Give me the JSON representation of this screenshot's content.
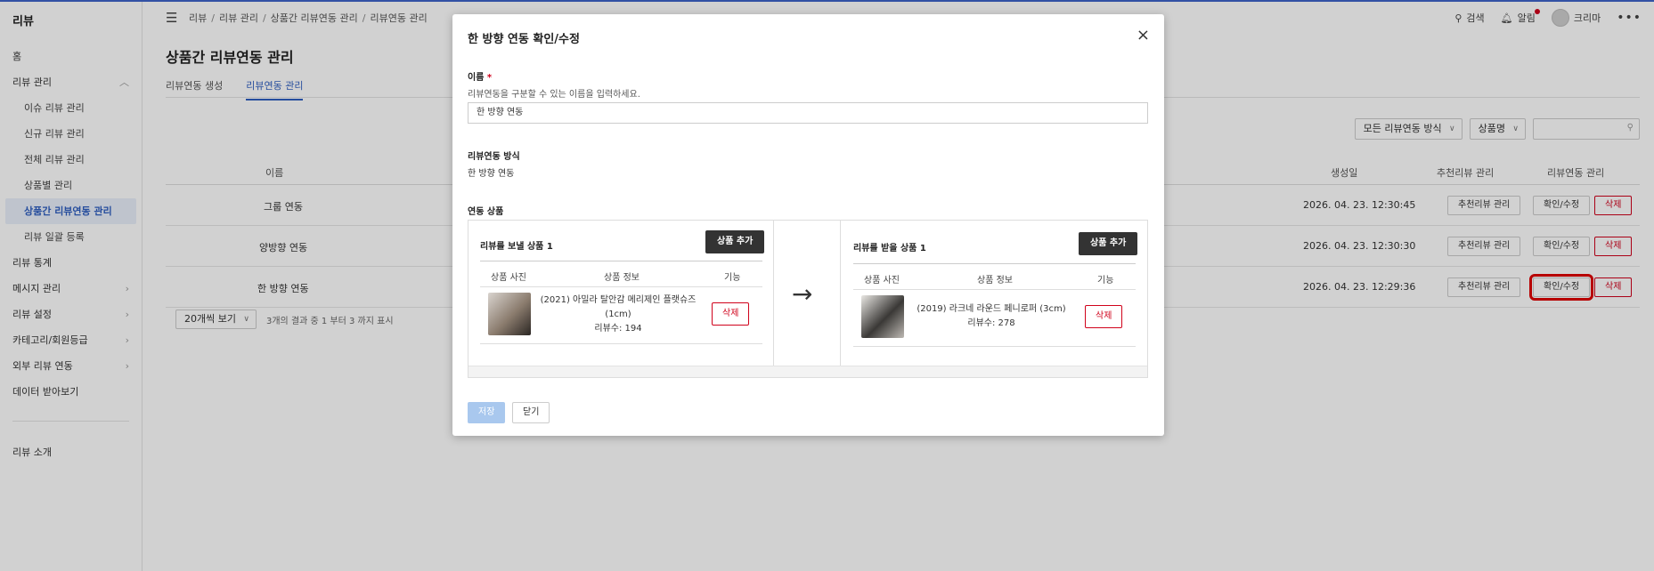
{
  "sidebar": {
    "brand": "리뷰",
    "items": [
      {
        "label": "홈"
      },
      {
        "label": "리뷰 관리"
      },
      {
        "label": "이슈 리뷰 관리"
      },
      {
        "label": "신규 리뷰 관리"
      },
      {
        "label": "전체 리뷰 관리"
      },
      {
        "label": "상품별 관리"
      },
      {
        "label": "상품간 리뷰연동 관리"
      },
      {
        "label": "리뷰 일괄 등록"
      },
      {
        "label": "리뷰 통계"
      },
      {
        "label": "메시지 관리"
      },
      {
        "label": "리뷰 설정"
      },
      {
        "label": "카테고리/회원등급"
      },
      {
        "label": "외부 리뷰 연동"
      },
      {
        "label": "데이터 받아보기"
      },
      {
        "label": "리뷰 소개"
      }
    ]
  },
  "header": {
    "breadcrumb": [
      "리뷰",
      "리뷰 관리",
      "상품간 리뷰연동 관리",
      "리뷰연동 관리"
    ],
    "search_label": "검색",
    "alarm_label": "알림",
    "user_name": "크리마",
    "more": "•••"
  },
  "page": {
    "title": "상품간 리뷰연동 관리",
    "tabs": [
      {
        "label": "리뷰연동 생성"
      },
      {
        "label": "리뷰연동 관리"
      }
    ]
  },
  "filters": {
    "mode_select": "모든 리뷰연동 방식",
    "field_select": "상품명"
  },
  "table": {
    "columns": [
      "이름",
      "생성일",
      "추천리뷰 관리",
      "리뷰연동 관리"
    ],
    "rows": [
      {
        "name": "그룹 연동",
        "created": "2026. 04. 23. 12:30:45"
      },
      {
        "name": "양방향 연동",
        "created": "2026. 04. 23. 12:30:30"
      },
      {
        "name": "한 방향 연동",
        "created": "2026. 04. 23. 12:29:36"
      }
    ],
    "recommend_btn": "추천리뷰 관리",
    "edit_btn": "확인/수정",
    "delete_btn": "삭제"
  },
  "pager": {
    "per_page": "20개씩 보기",
    "summary": "3개의 결과 중 1 부터 3 까지 표시"
  },
  "modal": {
    "title": "한 방향 연동 확인/수정",
    "close_icon": "×",
    "name_label": "이름",
    "required_mark": "*",
    "name_help": "리뷰연동을 구분할 수 있는 이름을 입력하세요.",
    "name_value": "한 방향 연동",
    "mode_label": "리뷰연동 방식",
    "mode_value": "한 방향 연동",
    "products_label": "연동 상품",
    "arrow": "→",
    "left": {
      "title": "리뷰를 보낼 상품 1",
      "add_btn": "상품 추가",
      "head_photo": "상품 사진",
      "head_info": "상품 정보",
      "head_action": "기능",
      "product_name": "(2021) 아밀라 탈안감 메리제인 플랫슈즈 (1cm)",
      "review_count": "리뷰수: 194",
      "delete_btn": "삭제"
    },
    "right": {
      "title": "리뷰를 받을 상품 1",
      "add_btn": "상품 추가",
      "head_photo": "상품 사진",
      "head_info": "상품 정보",
      "head_action": "기능",
      "product_name": "(2019) 라크네 라운드 페니로퍼 (3cm)",
      "review_count": "리뷰수: 278",
      "delete_btn": "삭제"
    },
    "save_btn": "저장",
    "close_btn": "닫기"
  },
  "colors": {
    "accent": "#2f5fc0",
    "danger": "#d0021b",
    "highlight": "#e00000"
  }
}
